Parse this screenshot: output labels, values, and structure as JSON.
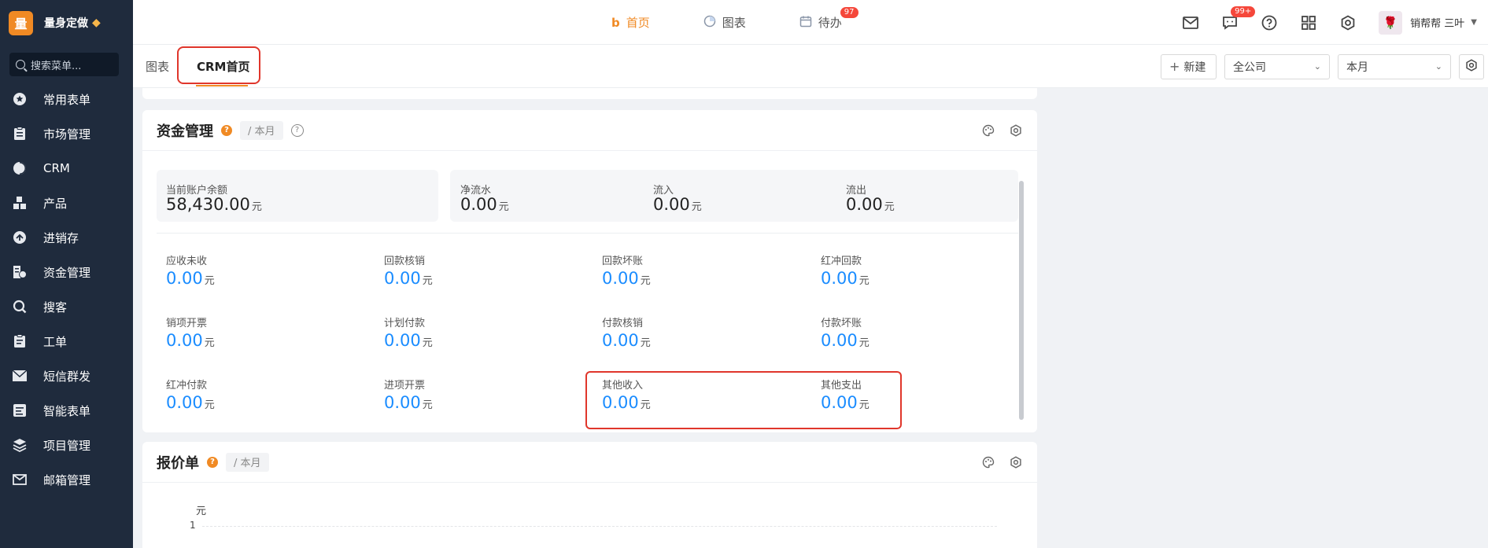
{
  "brand": {
    "logo_char": "量",
    "name": "量身定做"
  },
  "sidebar": {
    "search_placeholder": "搜索菜单...",
    "items": [
      {
        "label": "常用表单",
        "icon": "star-icon"
      },
      {
        "label": "市场管理",
        "icon": "clipboard-icon"
      },
      {
        "label": "CRM",
        "icon": "pie-chart-icon"
      },
      {
        "label": "产品",
        "icon": "boxes-icon"
      },
      {
        "label": "进销存",
        "icon": "inventory-icon"
      },
      {
        "label": "资金管理",
        "icon": "finance-icon"
      },
      {
        "label": "搜客",
        "icon": "search-icon"
      },
      {
        "label": "工单",
        "icon": "ticket-icon"
      },
      {
        "label": "短信群发",
        "icon": "envelope-icon"
      },
      {
        "label": "智能表单",
        "icon": "form-icon"
      },
      {
        "label": "项目管理",
        "icon": "layers-icon"
      },
      {
        "label": "邮箱管理",
        "icon": "mail-icon"
      }
    ]
  },
  "topnav": {
    "items": [
      {
        "label": "首页",
        "icon": "home-logo-icon",
        "active": true
      },
      {
        "label": "图表",
        "icon": "chart-icon",
        "active": false
      },
      {
        "label": "待办",
        "icon": "calendar-icon",
        "active": false,
        "badge": "97"
      }
    ]
  },
  "topright": {
    "chat_badge": "99+",
    "user_name": "销帮帮 三叶",
    "icons": [
      "mail-icon",
      "chat-icon",
      "help-icon",
      "apps-icon",
      "settings-icon"
    ]
  },
  "tabs": [
    {
      "label": "图表",
      "active": false
    },
    {
      "label": "CRM首页",
      "active": true
    }
  ],
  "toolbar": {
    "new_label": "新建",
    "company_select": "全公司",
    "period_select": "本月"
  },
  "finance": {
    "title": "资金管理",
    "period": "/ 本月",
    "unit": "元",
    "balance": {
      "label": "当前账户余额",
      "value": "58,430.00"
    },
    "flows": [
      {
        "label": "净流水",
        "value": "0.00"
      },
      {
        "label": "流入",
        "value": "0.00"
      },
      {
        "label": "流出",
        "value": "0.00"
      }
    ],
    "grid": [
      {
        "label": "应收未收",
        "value": "0.00"
      },
      {
        "label": "回款核销",
        "value": "0.00"
      },
      {
        "label": "回款坏账",
        "value": "0.00"
      },
      {
        "label": "红冲回款",
        "value": "0.00"
      },
      {
        "label": "销项开票",
        "value": "0.00"
      },
      {
        "label": "计划付款",
        "value": "0.00"
      },
      {
        "label": "付款核销",
        "value": "0.00"
      },
      {
        "label": "付款坏账",
        "value": "0.00"
      },
      {
        "label": "红冲付款",
        "value": "0.00"
      },
      {
        "label": "进项开票",
        "value": "0.00"
      },
      {
        "label": "其他收入",
        "value": "0.00"
      },
      {
        "label": "其他支出",
        "value": "0.00"
      }
    ]
  },
  "quote": {
    "title": "报价单",
    "period": "/ 本月",
    "axis_unit": "元",
    "tick": "1"
  },
  "colors": {
    "accent": "#f08a24",
    "value_blue": "#1a8cff",
    "highlight_red": "#e0362b",
    "sidebar_bg": "#1f2b3d"
  }
}
